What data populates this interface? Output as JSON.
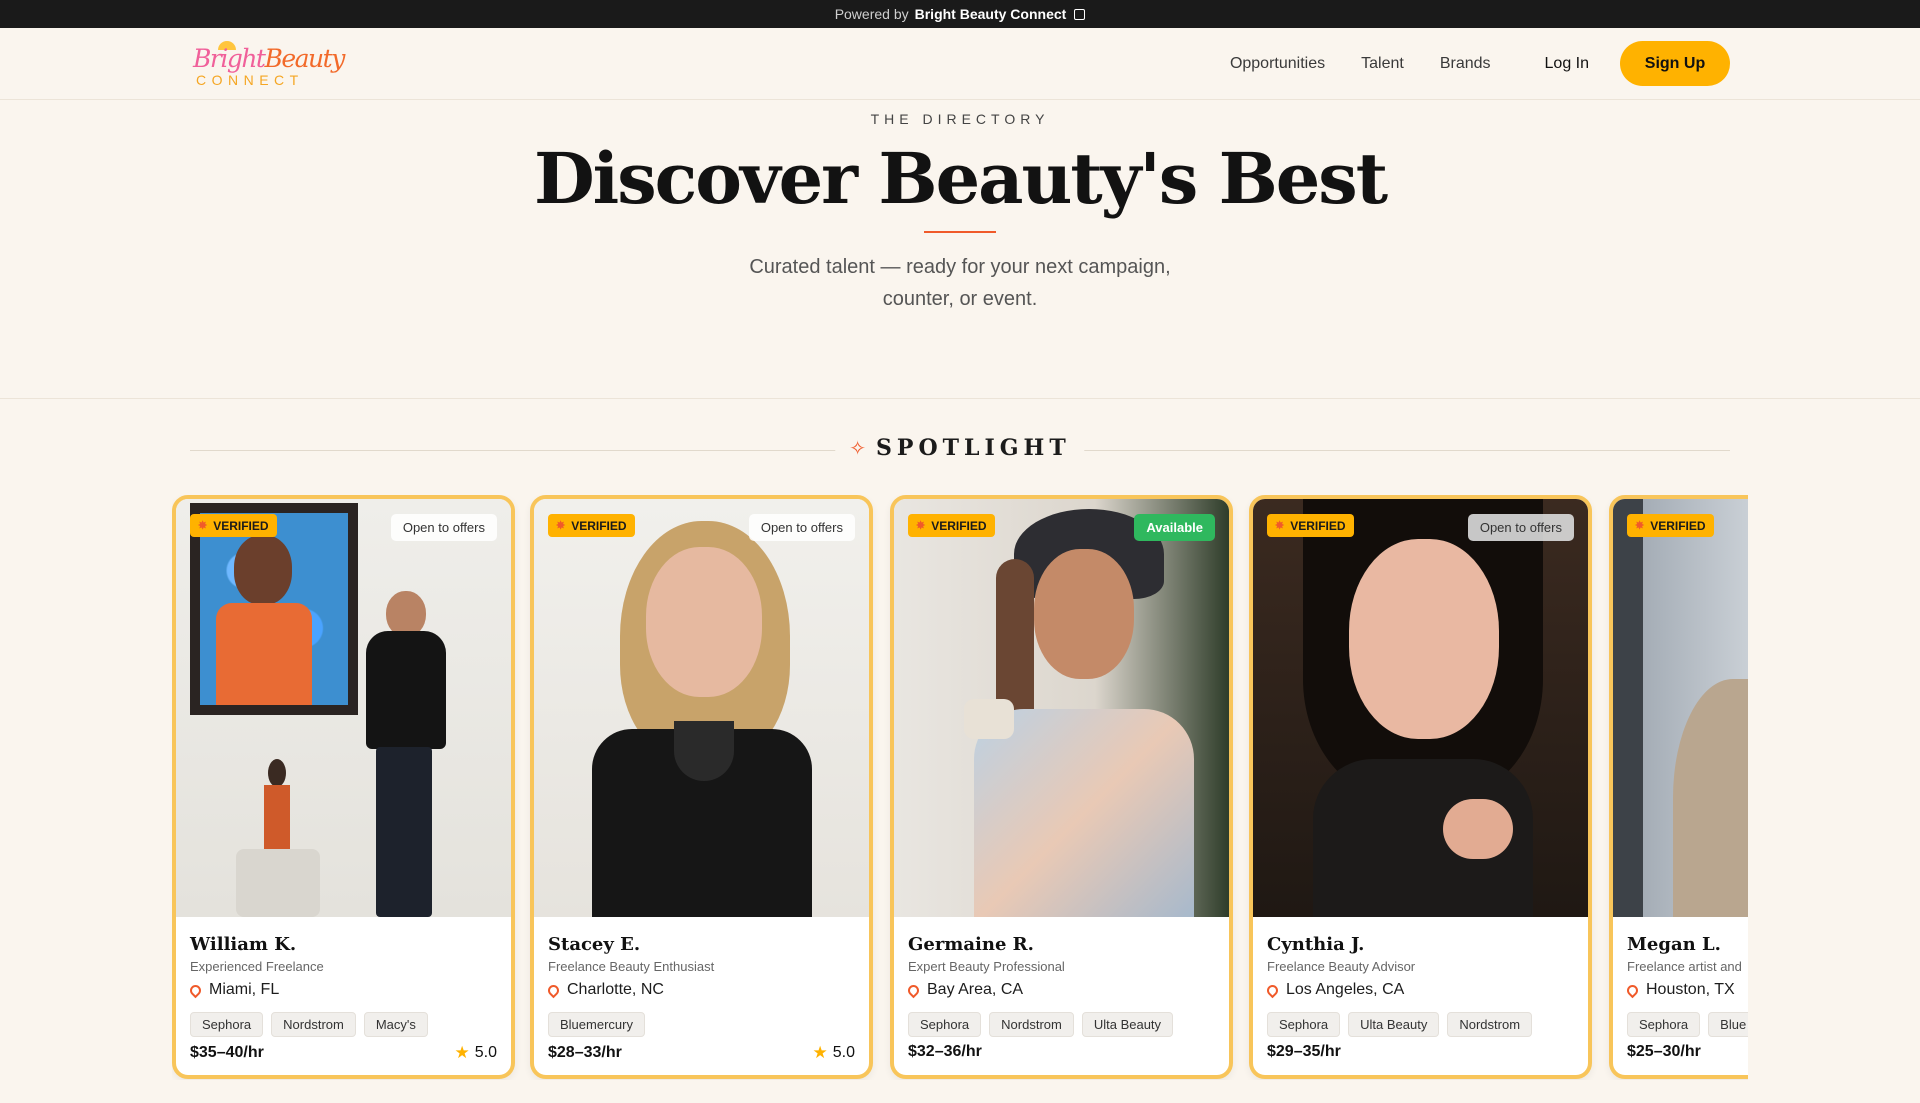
{
  "topbar": {
    "prefix": "Powered by",
    "brand": "Bright Beauty Connect"
  },
  "nav": {
    "logo_bright": "Bright",
    "logo_beauty": "Beauty",
    "logo_connect": "CONNECT",
    "links": [
      "Opportunities",
      "Talent",
      "Brands"
    ],
    "login": "Log In",
    "signup": "Sign Up"
  },
  "hero": {
    "eyebrow": "THE DIRECTORY",
    "title": "Discover Beauty's Best",
    "subtitle_line1": "Curated talent — ready for your next campaign,",
    "subtitle_line2": "counter, or event."
  },
  "spotlight": {
    "label": "SPOTLIGHT"
  },
  "cards": [
    {
      "badge": "VERIFIED",
      "status": "Open to offers",
      "name": "William K.",
      "role": "Experienced Freelance",
      "location": "Miami, FL",
      "tags": [
        "Sephora",
        "Nordstrom",
        "Macy's"
      ],
      "price": "$35–40/hr",
      "rating": "5.0"
    },
    {
      "badge": "VERIFIED",
      "status": "Open to offers",
      "name": "Stacey E.",
      "role": "Freelance Beauty Enthusiast",
      "location": "Charlotte, NC",
      "tags": [
        "Bluemercury"
      ],
      "price": "$28–33/hr",
      "rating": "5.0"
    },
    {
      "badge": "VERIFIED",
      "status": "Available",
      "name": "Germaine R.",
      "role": "Expert Beauty Professional",
      "location": "Bay Area, CA",
      "tags": [
        "Sephora",
        "Nordstrom",
        "Ulta Beauty"
      ],
      "price": "$32–36/hr",
      "rating": ""
    },
    {
      "badge": "VERIFIED",
      "status": "Open to offers",
      "name": "Cynthia J.",
      "role": "Freelance Beauty Advisor",
      "location": "Los Angeles, CA",
      "tags": [
        "Sephora",
        "Ulta Beauty",
        "Nordstrom"
      ],
      "price": "$29–35/hr",
      "rating": ""
    },
    {
      "badge": "VERIFIED",
      "status": "",
      "name": "Megan L.",
      "role": "Freelance artist and",
      "location": "Houston, TX",
      "tags": [
        "Sephora",
        "Blue"
      ],
      "price": "$25–30/hr",
      "rating": ""
    }
  ],
  "colors": {
    "accent": "#ffb200",
    "brand_orange": "#f05a2a",
    "card_border": "#f8c55a",
    "available": "#2fb85e",
    "background": "#faf5ee"
  },
  "icons": {
    "external": "external-link-icon",
    "spark": "spark-icon",
    "pin": "location-pin-icon",
    "star": "star-icon"
  }
}
